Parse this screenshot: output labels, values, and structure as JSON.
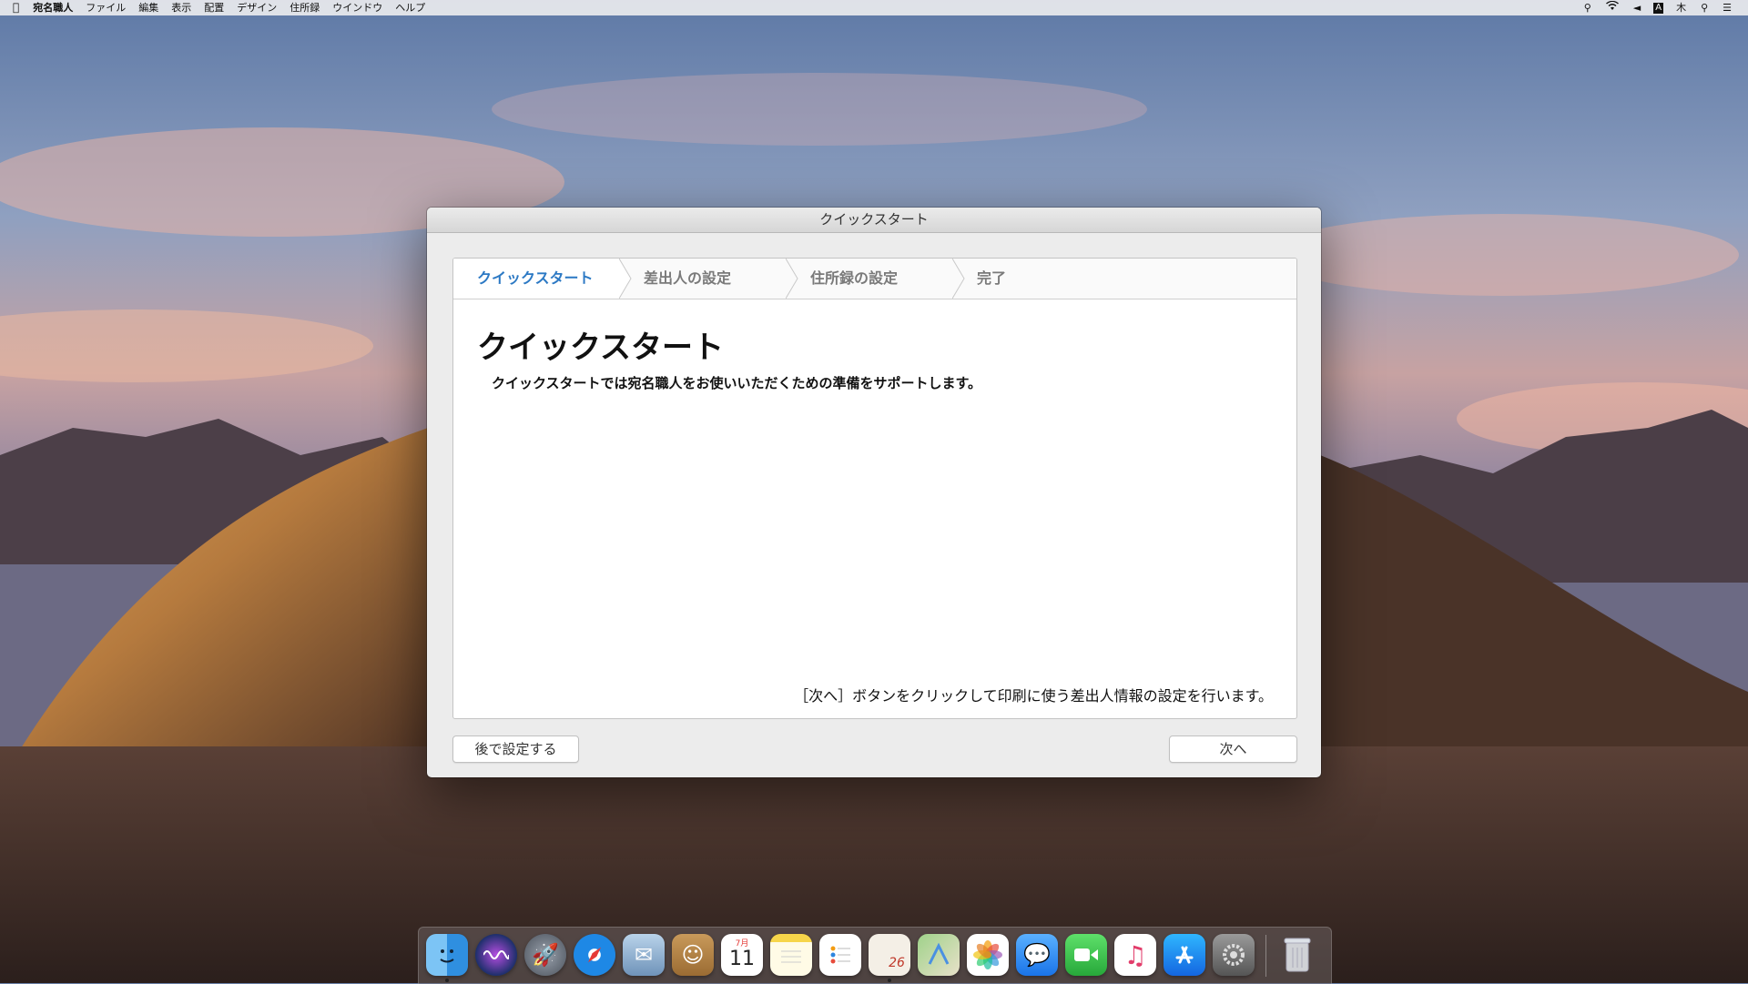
{
  "menubar": {
    "apple_icon": "apple-icon",
    "app_name": "宛名職人",
    "menus": [
      "ファイル",
      "編集",
      "表示",
      "配置",
      "デザイン",
      "住所録",
      "ウインドウ",
      "ヘルプ"
    ],
    "status": {
      "input_indicator": "A",
      "day": "木",
      "icons": [
        "accessibility-icon",
        "wifi-icon",
        "volume-icon",
        "search-icon",
        "list-icon"
      ]
    }
  },
  "dialog": {
    "window_title": "クイックスタート",
    "steps": [
      "クイックスタート",
      "差出人の設定",
      "住所録の設定",
      "完了"
    ],
    "active_step": 0,
    "page_title": "クイックスタート",
    "intro_text": "クイックスタートでは宛名職人をお使いいただくための準備をサポートします。",
    "hint_text": "［次へ］ボタンをクリックして印刷に使う差出人情報の設定を行います。",
    "later_button": "後で設定する",
    "next_button": "次へ",
    "accent_color": "#2c79c4"
  },
  "dock": {
    "apps": [
      {
        "name": "finder-icon",
        "label": "Finder",
        "color": "#4aa3ec"
      },
      {
        "name": "siri-icon",
        "label": "Siri",
        "color": "#2b2f57"
      },
      {
        "name": "launchpad-icon",
        "label": "Launchpad",
        "color": "#6b7280"
      },
      {
        "name": "safari-icon",
        "label": "Safari",
        "color": "#1e88e5"
      },
      {
        "name": "mail-icon",
        "label": "Mail",
        "color": "#7fa6c8"
      },
      {
        "name": "contacts-icon",
        "label": "Contacts",
        "color": "#b98a4a"
      },
      {
        "name": "calendar-icon",
        "label": "Calendar",
        "color": "#ffffff",
        "month": "7月",
        "day": "11"
      },
      {
        "name": "notes-icon",
        "label": "Notes",
        "color": "#f7e27a"
      },
      {
        "name": "reminders-icon",
        "label": "Reminders",
        "color": "#ffffff"
      },
      {
        "name": "atena-app-icon",
        "label": "宛名職人",
        "color": "#f4efe6",
        "badge": "26"
      },
      {
        "name": "maps-icon",
        "label": "Maps",
        "color": "#8fc27a"
      },
      {
        "name": "photos-icon",
        "label": "Photos",
        "color": "#ffffff"
      },
      {
        "name": "messages-icon",
        "label": "Messages",
        "color": "#2b8cf3"
      },
      {
        "name": "facetime-icon",
        "label": "FaceTime",
        "color": "#3ac04d"
      },
      {
        "name": "itunes-icon",
        "label": "iTunes",
        "color": "#ffffff"
      },
      {
        "name": "app-store-icon",
        "label": "App Store",
        "color": "#1a8df0"
      },
      {
        "name": "system-preferences-icon",
        "label": "System Preferences",
        "color": "#8a8a8a"
      }
    ],
    "trash": {
      "name": "trash-icon",
      "label": "Trash"
    }
  }
}
